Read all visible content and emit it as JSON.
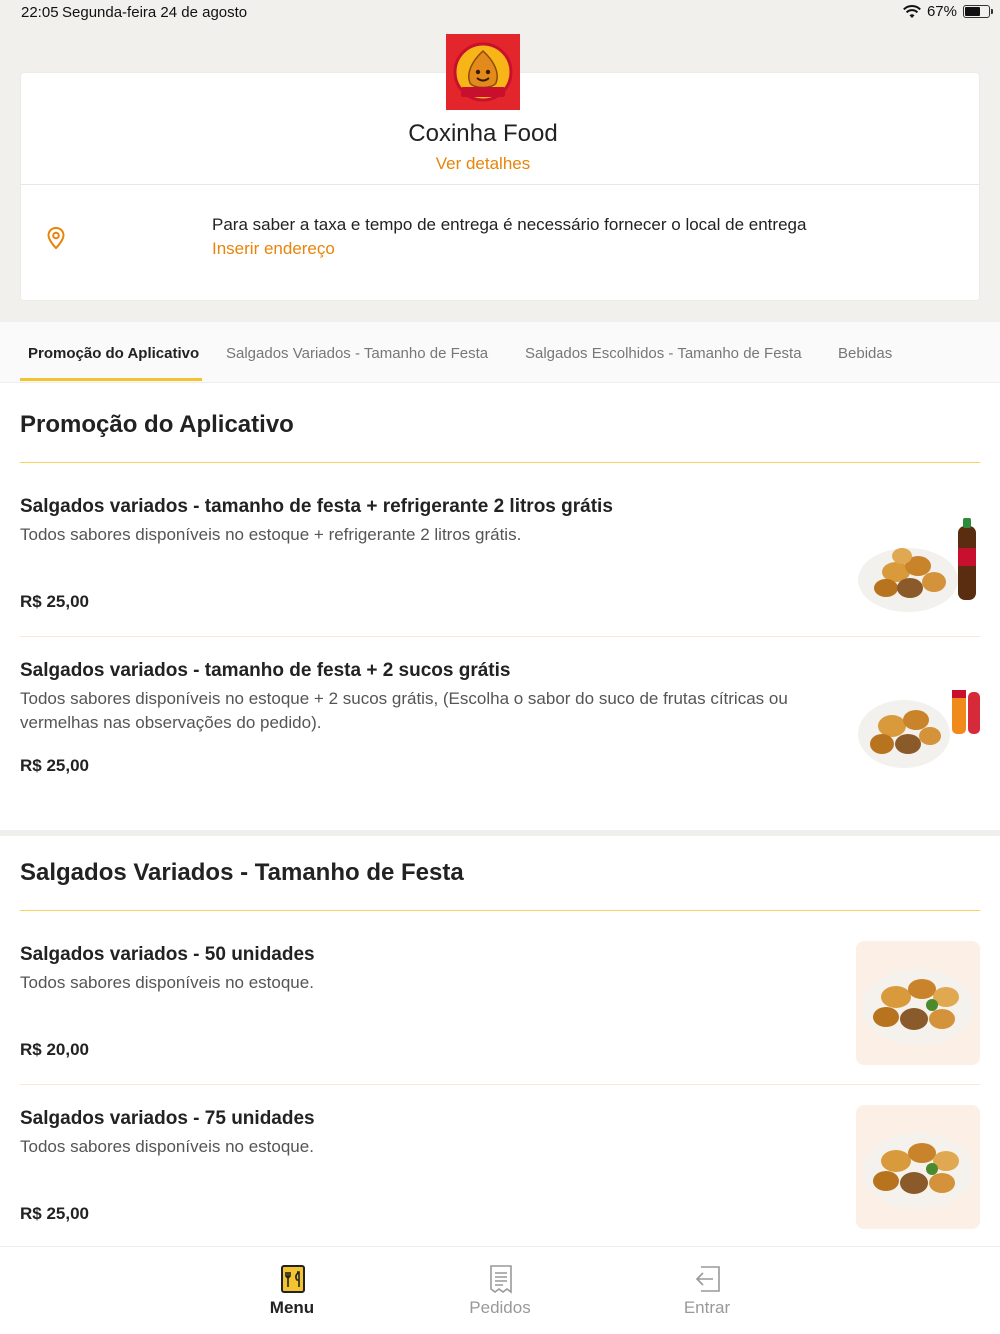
{
  "status_bar": {
    "time": "22:05",
    "date": "Segunda-feira 24 de agosto",
    "battery": "67%",
    "battery_level": 0.67
  },
  "restaurant": {
    "logo_text": "Coxinha Food",
    "name": "Coxinha Food",
    "details_link": "Ver detalhes",
    "delivery_notice": "Para saber a taxa e tempo de entrega é necessário fornecer o local de entrega",
    "address_link": "Inserir endereço"
  },
  "tabs": [
    {
      "label": "Promoção do Aplicativo",
      "active": true
    },
    {
      "label": "Salgados Variados - Tamanho de Festa",
      "active": false
    },
    {
      "label": "Salgados Escolhidos - Tamanho de Festa",
      "active": false
    },
    {
      "label": "Bebidas",
      "active": false
    }
  ],
  "sections": [
    {
      "title": "Promoção do Aplicativo",
      "items": [
        {
          "name": "Salgados variados - tamanho de festa + refrigerante 2 litros grátis",
          "description": "Todos sabores disponíveis no estoque + refrigerante 2 litros grátis.",
          "price": "R$ 25,00",
          "image": "snacks-with-soda-bottle"
        },
        {
          "name": "Salgados variados - tamanho de festa + 2 sucos grátis",
          "description": "Todos sabores disponíveis no estoque + 2 sucos grátis, (Escolha o sabor do suco de frutas cítricas ou vermelhas nas observações do pedido).",
          "price": "R$ 25,00",
          "image": "snacks-with-juice-bottles"
        }
      ]
    },
    {
      "title": "Salgados Variados - Tamanho de Festa",
      "items": [
        {
          "name": "Salgados variados - 50 unidades",
          "description": "Todos sabores disponíveis no estoque.",
          "price": "R$ 20,00",
          "image": "snacks-platter"
        },
        {
          "name": "Salgados variados - 75 unidades",
          "description": "Todos sabores disponíveis no estoque.",
          "price": "R$ 25,00",
          "image": "snacks-platter"
        }
      ]
    }
  ],
  "bottom_nav": [
    {
      "label": "Menu",
      "icon": "menu-book-icon",
      "active": true
    },
    {
      "label": "Pedidos",
      "icon": "receipt-icon",
      "active": false
    },
    {
      "label": "Entrar",
      "icon": "login-icon",
      "active": false
    }
  ],
  "colors": {
    "accent": "#e8840a",
    "tab_underline": "#f4c430",
    "logo_bg": "#e3262c"
  }
}
